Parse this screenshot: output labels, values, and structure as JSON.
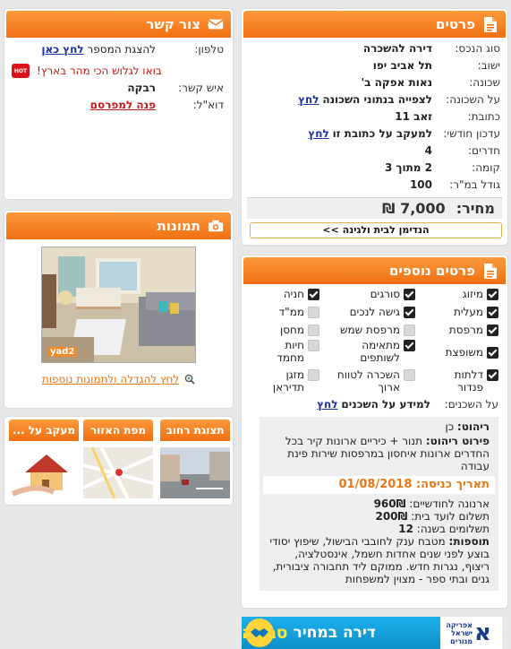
{
  "details": {
    "title": "פרטים",
    "rows": [
      {
        "label": "סוג הנכס:",
        "value": "דירה להשכרה"
      },
      {
        "label": "ישוב:",
        "value": "תל אביב יפו"
      },
      {
        "label": "שכונה:",
        "value": "נאות אפקה ב'"
      },
      {
        "label": "על השכונה:",
        "value": "לצפייה בנתוני השכונה",
        "link": "לחץ"
      },
      {
        "label": "כתובת:",
        "value": "זאב 11"
      },
      {
        "label": "עדכון חודשי:",
        "value": "למעקב על כתובת זו",
        "link": "לחץ"
      },
      {
        "label": "חדרים:",
        "value": "4"
      },
      {
        "label": "קומה:",
        "value": "2 מתוך 3"
      },
      {
        "label": "גודל במ\"ר:",
        "value": "100"
      }
    ],
    "price_label": "מחיר:",
    "price_value": "7,000 ₪",
    "opportunity": "הנדימן לבית ולגינה >>"
  },
  "contact": {
    "title": "צור קשר",
    "phone_label": "טלפון:",
    "phone_text": "להצגת המספר",
    "phone_link": "לחץ כאן",
    "promo": "בואו לגלוש הכי מהר בארץ!",
    "promo_logo": "HOT",
    "person_label": "איש קשר:",
    "person_value": "רבקה",
    "email_label": "דוא\"ל:",
    "email_link": "פנה למפרסם"
  },
  "photos": {
    "title": "תמונות",
    "watermark": "yad2",
    "enlarge_link": "לחץ להגדלה ולתמונות נוספות"
  },
  "tabs": [
    {
      "label": "תצוגת רחוב"
    },
    {
      "label": "מפת האזור"
    },
    {
      "label": "מעקב על ..."
    }
  ],
  "extra": {
    "title": "פרטים נוספים",
    "features": [
      {
        "label": "מיזוג",
        "on": true
      },
      {
        "label": "סורגים",
        "on": true
      },
      {
        "label": "חניה",
        "on": true
      },
      {
        "label": "מעלית",
        "on": true
      },
      {
        "label": "גישה לנכים",
        "on": true
      },
      {
        "label": "ממ\"ד",
        "on": false
      },
      {
        "label": "מרפסת",
        "on": true
      },
      {
        "label": "מרפסת שמש",
        "on": false
      },
      {
        "label": "מחסן",
        "on": false
      },
      {
        "label": "משופצת",
        "on": true
      },
      {
        "label": "מתאימה לשותפים",
        "on": true
      },
      {
        "label": "חיות מחמד",
        "on": false
      },
      {
        "label": "דלתות פנדור",
        "on": true
      },
      {
        "label": "השכרה לטווח ארוך",
        "on": false
      },
      {
        "label": "מזגן תדיראן",
        "on": false
      }
    ],
    "neighbors_label": "על השכנים:",
    "neighbors_value": "למידע על השכנים",
    "neighbors_link": "לחץ",
    "furniture_label": "ריהוט:",
    "furniture_value": "כן",
    "furniture_detail_label": "פירוט ריהוט:",
    "furniture_detail_value": "תנור + כיריים ארונות קיר בכל החדרים ארונות איחסון במרפסות שירות פינת עבודה",
    "entry_label": "תאריך כניסה:",
    "entry_value": "01/08/2018",
    "arnona_label": "ארנונה לחודשיים:",
    "arnona_value": "960₪",
    "vaad_label": "תשלום לועד בית:",
    "vaad_value": "200₪",
    "payments_label": "תשלומים בשנה:",
    "payments_value": "12",
    "extras_label": "תוספות:",
    "extras_value": "מטבח ענק לחובבי הבישול, שיפוץ יסודי בוצע לפני שנים אחדות חשמל, אינסטלציה, ריצוף, נגרות חדש. ממוקם ליד תחבורה ציבורית, גנים ובתי ספר - מצוין למשפחות"
  },
  "banner": {
    "brand": "אפריקה ישראל מגורים",
    "text_white": "דירה במחיר",
    "text_yellow": "סגירה"
  },
  "colors": {
    "orange": "#f27a1a",
    "link": "#1a2fa0",
    "red": "#c01818"
  }
}
